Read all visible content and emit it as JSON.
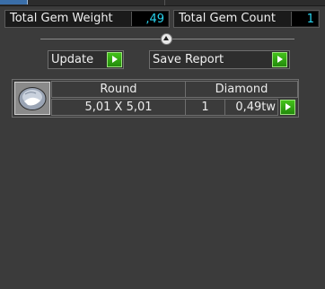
{
  "summary": {
    "total_weight_label": "Total Gem Weight",
    "total_weight_value": ",49",
    "total_count_label": "Total Gem Count",
    "total_count_value": "1"
  },
  "toolbar": {
    "update_label": "Update",
    "save_report_label": "Save Report"
  },
  "gems": [
    {
      "shape": "Round",
      "type": "Diamond",
      "size": "5,01 X 5,01",
      "quantity": "1",
      "weight": "0,49tw",
      "icon": "round-gem-icon"
    }
  ],
  "colors": {
    "accent_value": "#29d3ee",
    "go_button": "#2fa614",
    "background": "#3b3b3b"
  }
}
